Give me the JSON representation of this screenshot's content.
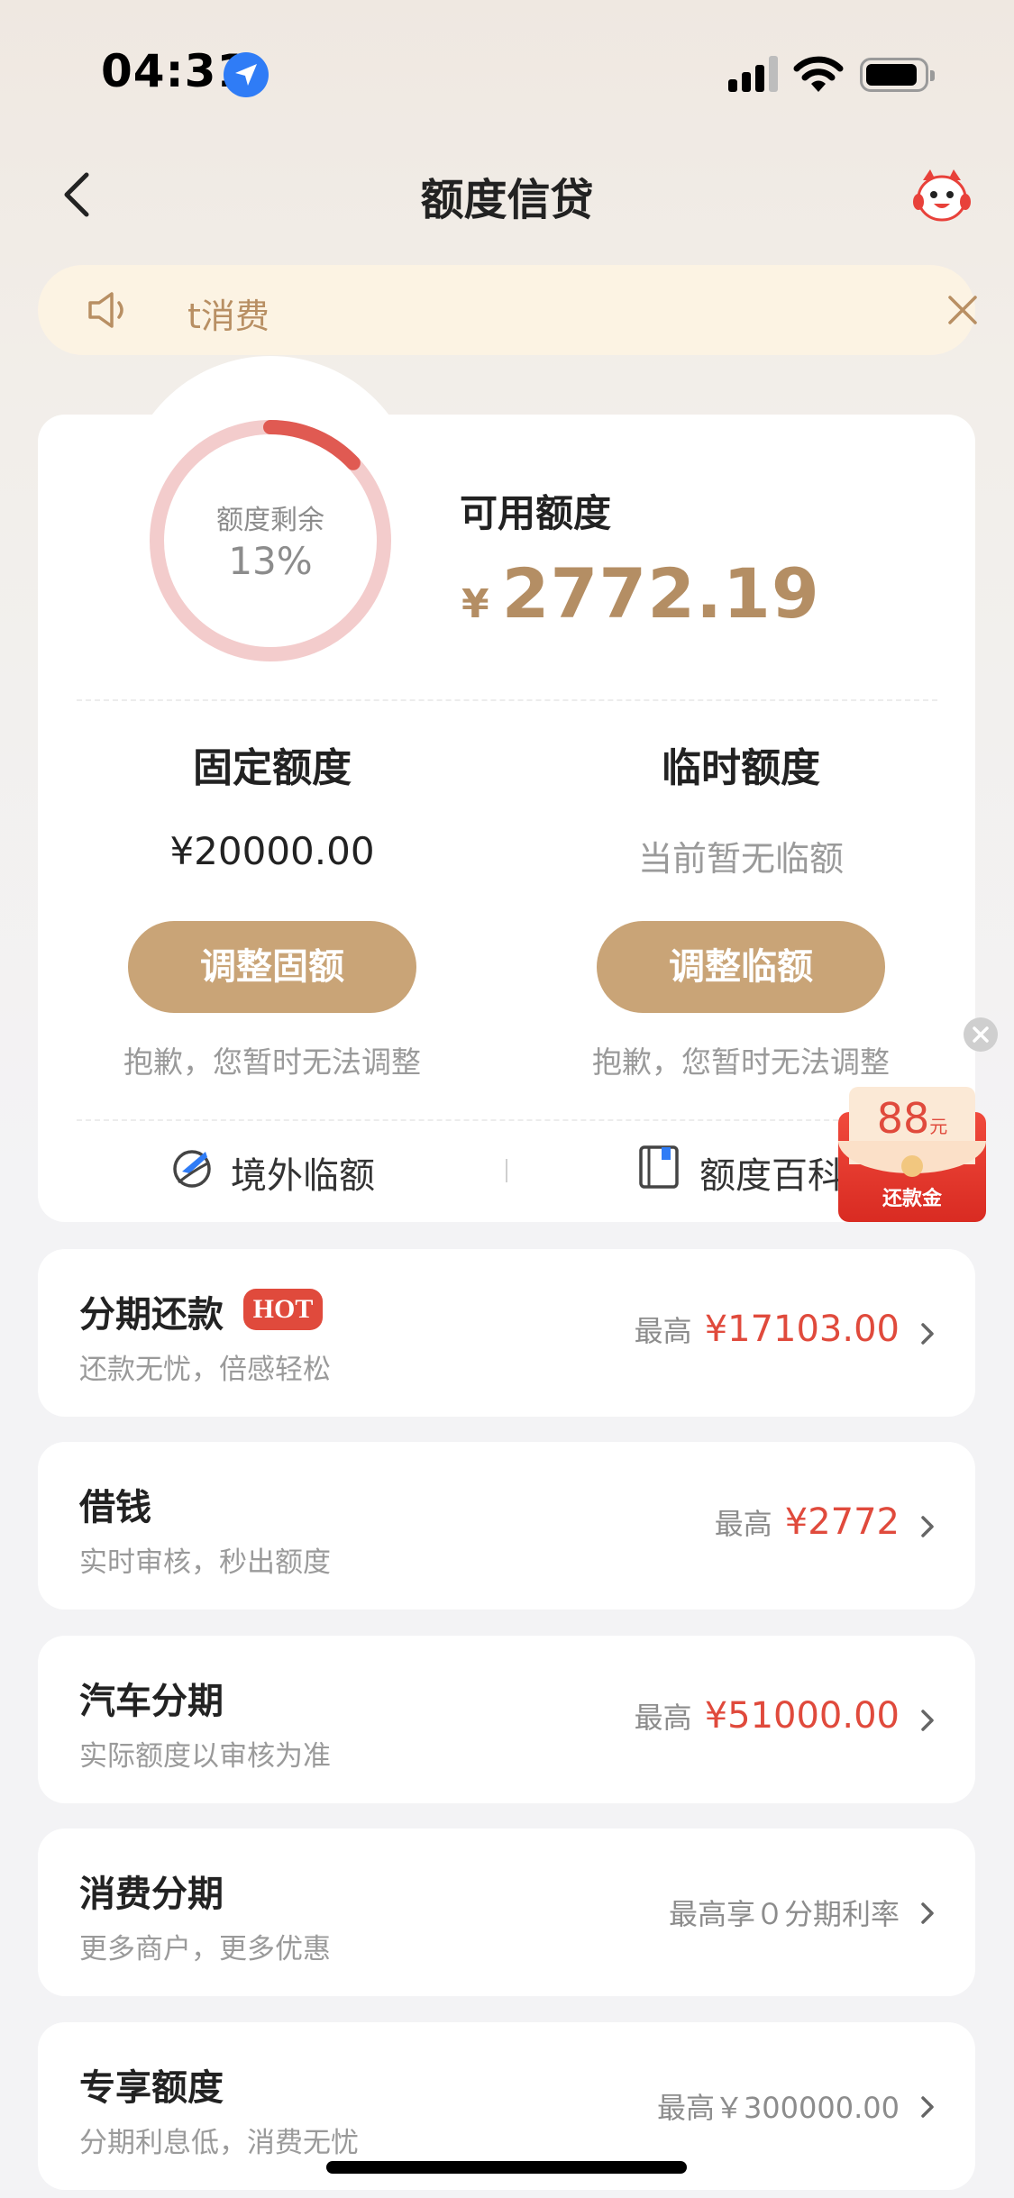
{
  "status_bar": {
    "time": "04:31"
  },
  "nav": {
    "title": "额度信贷"
  },
  "notice": {
    "text": "t消费"
  },
  "credit": {
    "ring_label": "额度剩余",
    "ring_percent_text": "13%",
    "ring_fraction": 0.13,
    "available_label": "可用额度",
    "available_currency": "¥",
    "available_amount": "2772.19",
    "fixed": {
      "title": "固定额度",
      "value": "¥20000.00",
      "button": "调整固额",
      "hint": "抱歉，您暂时无法调整"
    },
    "temp": {
      "title": "临时额度",
      "value": "当前暂无临额",
      "button": "调整临额",
      "hint": "抱歉，您暂时无法调整"
    },
    "links": {
      "overseas": "境外临额",
      "wiki": "额度百科"
    }
  },
  "red_packet": {
    "amount": "88",
    "unit": "元",
    "label": "还款金"
  },
  "products": [
    {
      "name": "分期还款",
      "badge": "HOT",
      "sub": "还款无忧，倍感轻松",
      "prefix": "最高",
      "amount": "¥17103.00"
    },
    {
      "name": "借钱",
      "sub": "实时审核，秒出额度",
      "prefix": "最高",
      "amount": "¥2772"
    },
    {
      "name": "汽车分期",
      "sub": "实际额度以审核为准",
      "prefix": "最高",
      "amount": "¥51000.00"
    },
    {
      "name": "消费分期",
      "sub": "更多商户，更多优惠",
      "text": "最高享０分期利率"
    },
    {
      "name": "专享额度",
      "sub": "分期利息低，消费无忧",
      "text": "最高￥300000.00"
    }
  ],
  "colors": {
    "accent_gold": "#c9a477",
    "amount_gold": "#b48e64",
    "red": "#e04a3c",
    "ring_track": "#f3cccc",
    "ring_fill": "#e05a52"
  }
}
